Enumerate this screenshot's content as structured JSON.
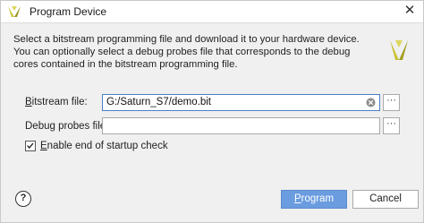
{
  "window": {
    "title": "Program Device",
    "close_glyph": "✕"
  },
  "description": "Select a bitstream programming file and download it to your hardware device. You can optionally select a debug probes file that corresponds to the debug cores contained in the bitstream programming file.",
  "fields": {
    "bitstream": {
      "label_mnemonic": "B",
      "label_rest": "itstream file:",
      "value": "G:/Saturn_S7/demo.bit"
    },
    "debug_probes": {
      "label_start": "Debu",
      "label_mnemonic": "g",
      "label_rest": " probes file:",
      "value": ""
    },
    "browse_label": "···"
  },
  "startup_check": {
    "checked": true,
    "label_mnemonic": "E",
    "label_rest": "nable end of startup check"
  },
  "buttons": {
    "help": "?",
    "program_mnemonic": "P",
    "program_rest": "rogram",
    "cancel": "Cancel"
  },
  "colors": {
    "primary_button": "#6a9cdf",
    "focus_border": "#4a7fc8",
    "logo": "#c9c337"
  },
  "icons": {
    "app": "vivado-logo-icon",
    "corner": "vivado-logo-icon",
    "clear": "clear-circle-icon",
    "check": "checkmark-icon"
  }
}
